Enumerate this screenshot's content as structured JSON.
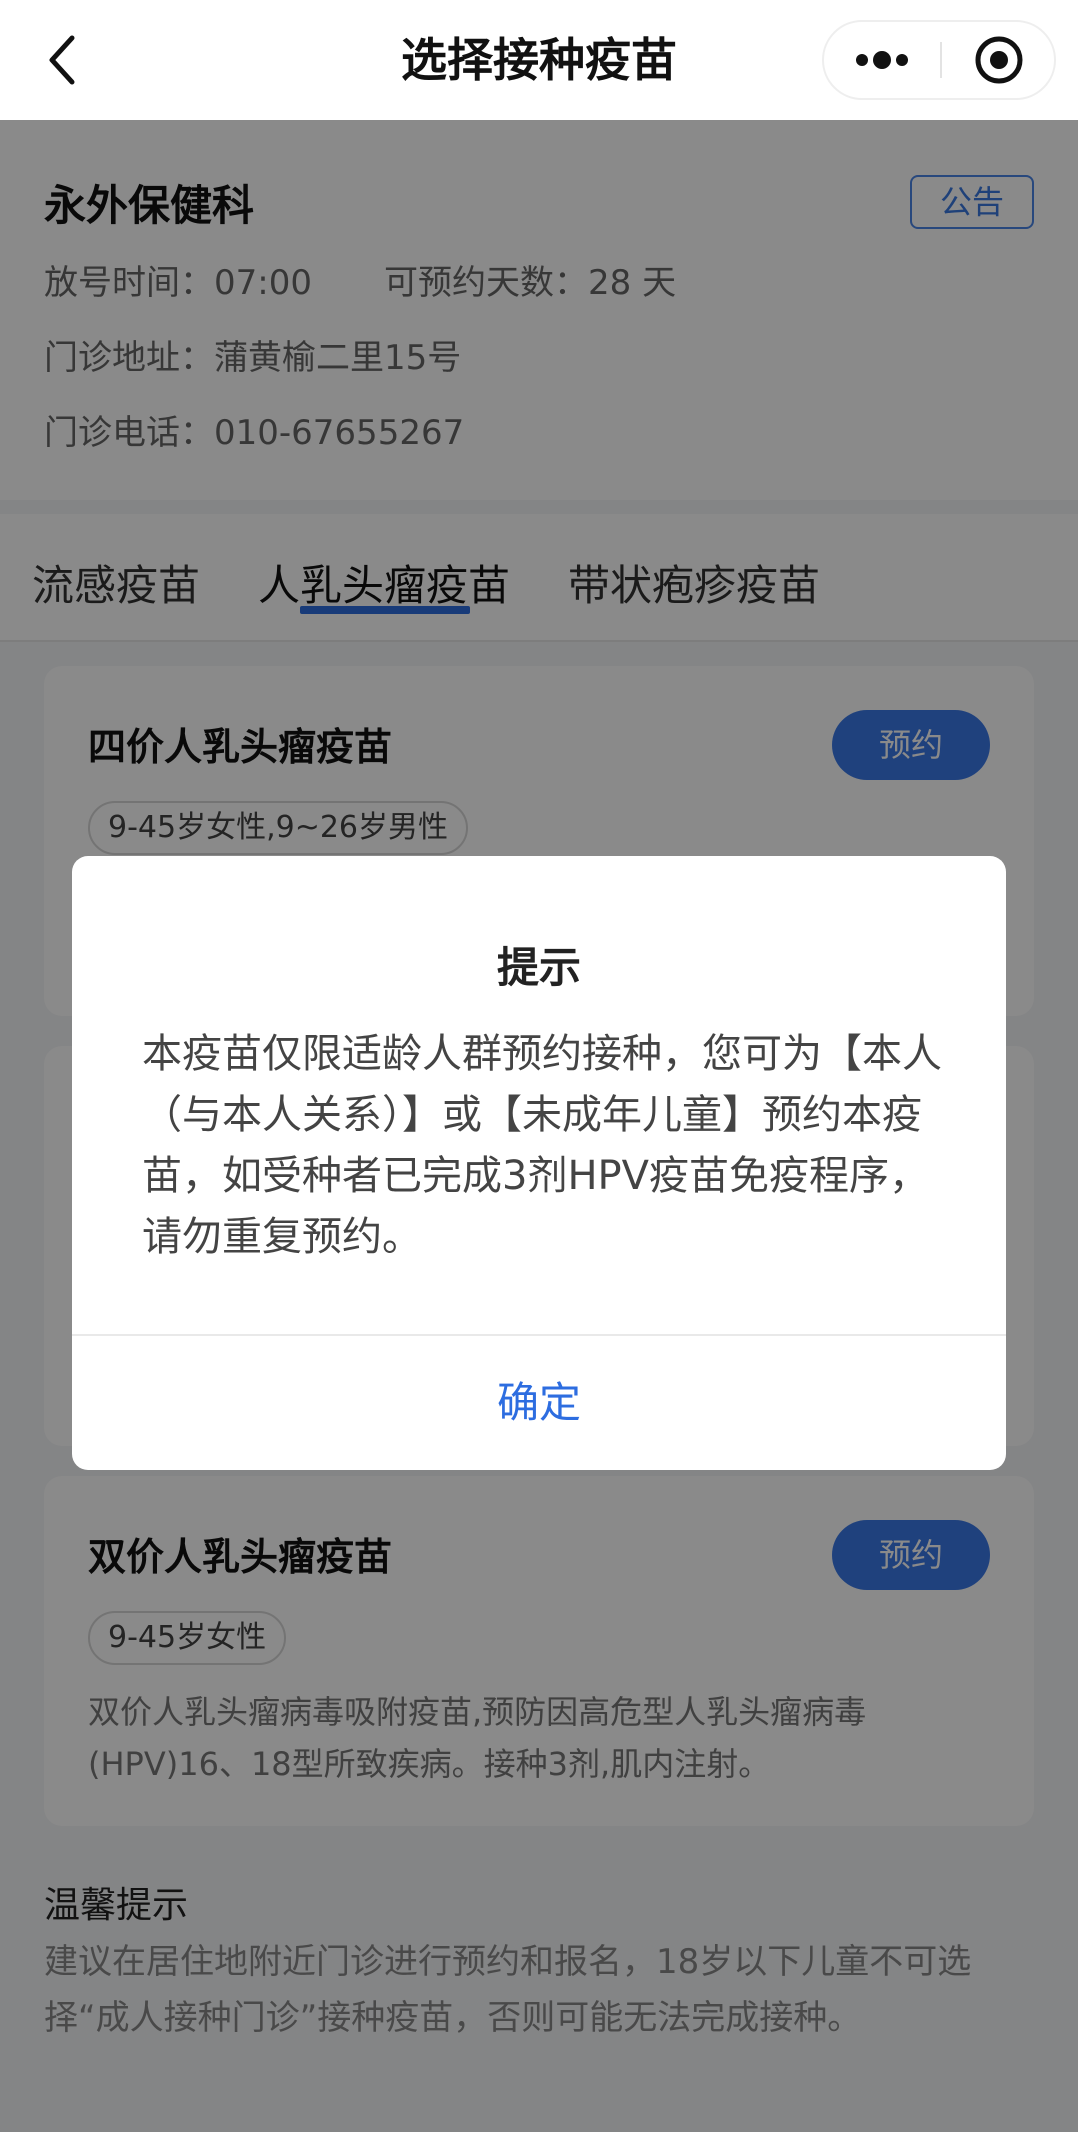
{
  "nav": {
    "title": "选择接种疫苗",
    "back_icon": "chevron-left-icon",
    "more_icon": "more-dots-icon",
    "close_icon": "target-circle-icon"
  },
  "clinic": {
    "name": "永外保健科",
    "notice_button": "公告",
    "release_label": "放号时间：",
    "release_value": "07:00",
    "days_label": "可预约天数：",
    "days_value": "28 天",
    "address_label": "门诊地址：",
    "address_value": "蒲黄榆二里15号",
    "phone_label": "门诊电话：",
    "phone_value": "010-67655267"
  },
  "tabs": [
    {
      "label": "流感疫苗",
      "active": false
    },
    {
      "label": "人乳头瘤疫苗",
      "active": true
    },
    {
      "label": "带状疱疹疫苗",
      "active": false
    }
  ],
  "vaccines": [
    {
      "name": "四价人乳头瘤疫苗",
      "button": "预约",
      "tag": "9-45岁女性,9~26岁男性",
      "description": ""
    },
    {
      "name": "",
      "button": "",
      "tag": "",
      "description": ""
    },
    {
      "name": "双价人乳头瘤疫苗",
      "button": "预约",
      "tag": "9-45岁女性",
      "description": "双价人乳头瘤病毒吸附疫苗,预防因高危型人乳头瘤病毒(HPV)16、18型所致疾病。接种3剂,肌内注射。"
    }
  ],
  "tips": {
    "title": "温馨提示",
    "text": "建议在居住地附近门诊进行预约和报名，18岁以下儿童不可选择“成人接种门诊”接种疫苗，否则可能无法完成接种。"
  },
  "dialog": {
    "title": "提示",
    "body": "本疫苗仅限适龄人群预约接种，您可为【本人（与本人关系）】或【未成年儿童】预约本疫苗，如受种者已完成3剂HPV疫苗免疫程序，请勿重复预约。",
    "confirm": "确定"
  },
  "colors": {
    "accent": "#2d6de0",
    "button": "#3a78e8",
    "mask": "rgba(0,0,0,0.46)"
  }
}
